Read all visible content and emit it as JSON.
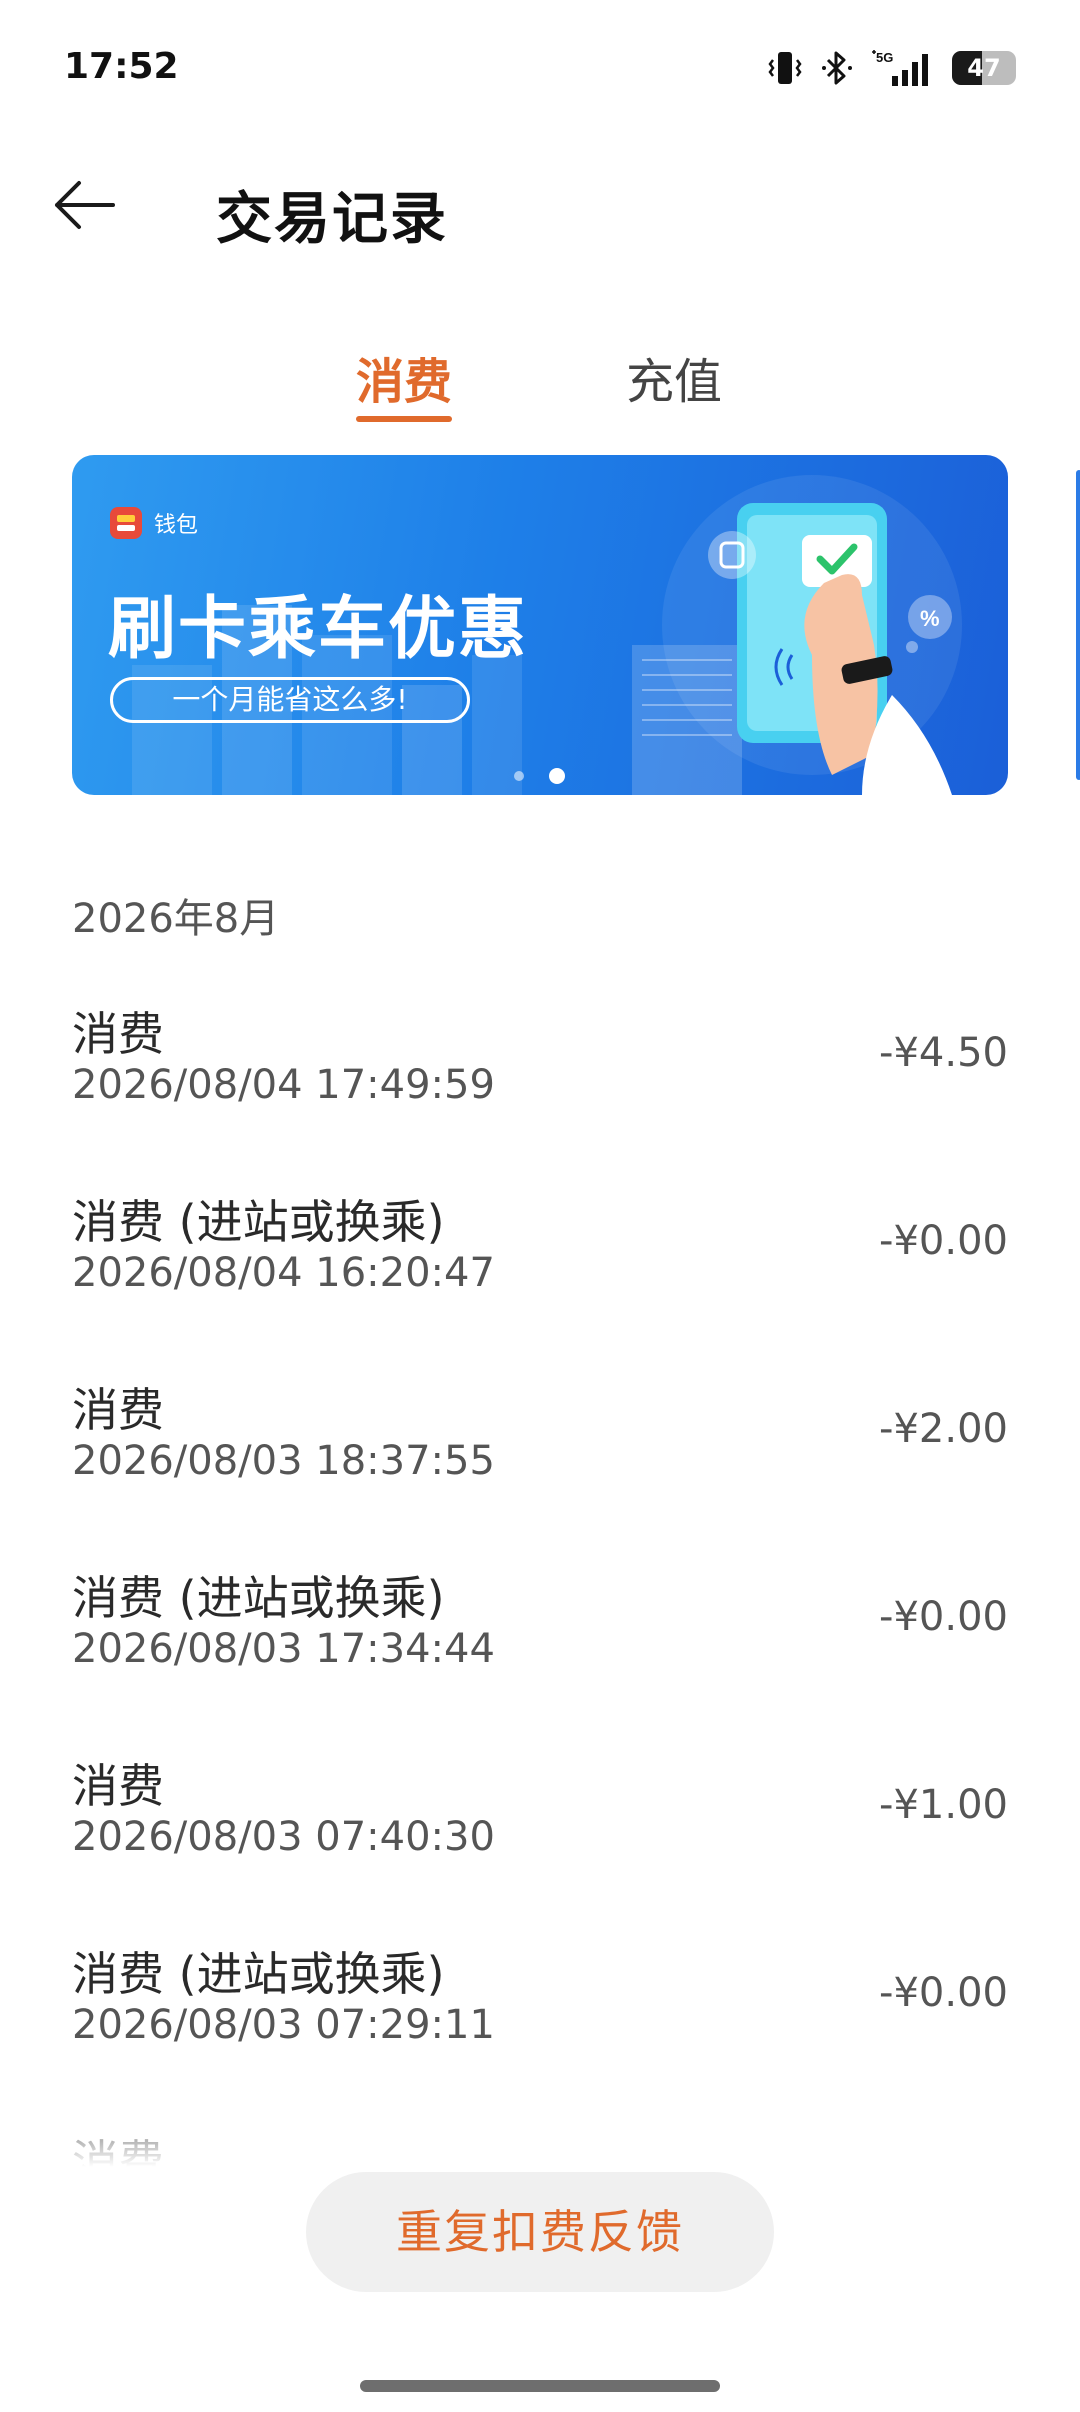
{
  "status_bar": {
    "time": "17:52",
    "battery_level": "47",
    "network_label": "5G",
    "icons": [
      "vibrate-icon",
      "bluetooth-icon",
      "5g-signal-icon",
      "battery-icon"
    ]
  },
  "header": {
    "title": "交易记录",
    "back_icon": "arrow-left-icon"
  },
  "tabs": [
    {
      "label": "消费",
      "active": true
    },
    {
      "label": "充值",
      "active": false
    }
  ],
  "banner": {
    "brand": "钱包",
    "title": "刷卡乘车优惠",
    "subtitle": "一个月能省这么多!",
    "page_count": 2,
    "active_page": 2,
    "colors": {
      "start": "#2f9bf0",
      "end": "#1b5fd8"
    }
  },
  "month_label": "2026年8月",
  "transactions": [
    {
      "type": "消费",
      "time": "2026/08/04 17:49:59",
      "amount": "-¥4.50"
    },
    {
      "type": "消费 (进站或换乘)",
      "time": "2026/08/04 16:20:47",
      "amount": "-¥0.00"
    },
    {
      "type": "消费",
      "time": "2026/08/03 18:37:55",
      "amount": "-¥2.00"
    },
    {
      "type": "消费 (进站或换乘)",
      "time": "2026/08/03 17:34:44",
      "amount": "-¥0.00"
    },
    {
      "type": "消费",
      "time": "2026/08/03 07:40:30",
      "amount": "-¥1.00"
    },
    {
      "type": "消费 (进站或换乘)",
      "time": "2026/08/03 07:29:11",
      "amount": "-¥0.00"
    },
    {
      "type": "消费",
      "time": "",
      "amount": ""
    }
  ],
  "feedback_button": "重复扣费反馈",
  "colors": {
    "accent": "#e06a2c",
    "text_primary": "#2a2a2a",
    "text_secondary": "#555555",
    "button_bg": "#f0f0f0"
  }
}
